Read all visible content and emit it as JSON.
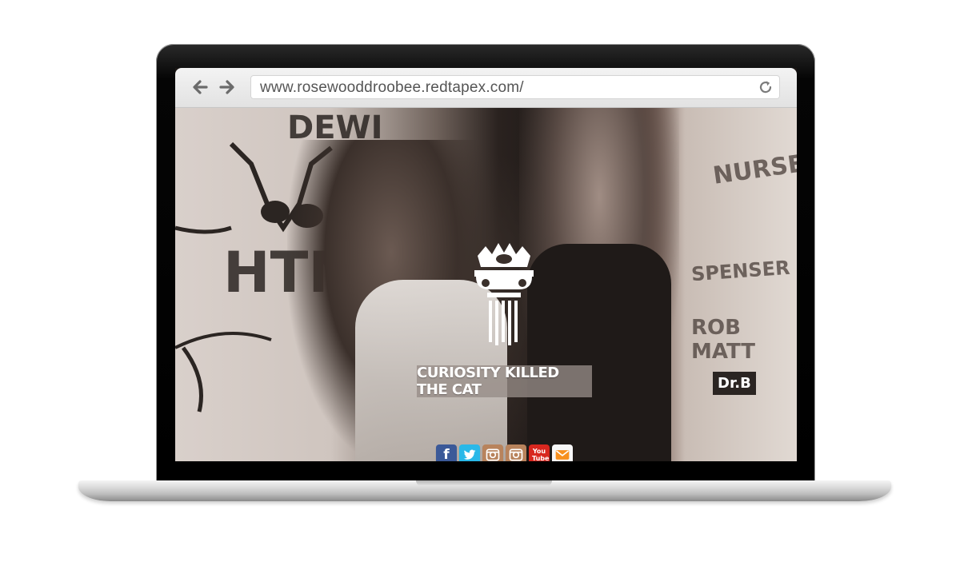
{
  "browser": {
    "url": "www.rosewooddroobee.redtapex.com/",
    "back_icon": "arrow-left-icon",
    "forward_icon": "arrow-right-icon",
    "reload_icon": "reload-icon"
  },
  "hero": {
    "logo_icon": "crown-column-logo",
    "title": "CURIOSITY KILLED THE CAT",
    "wall_left_text": [
      "DEWI",
      "HTN"
    ],
    "wall_right_text": [
      "NURSE",
      "SPENSER",
      "ROB MATT",
      "Dr.B"
    ]
  },
  "socials": [
    {
      "name": "facebook",
      "glyph": "f",
      "color": "#3b5998"
    },
    {
      "name": "twitter",
      "glyph": "t",
      "color": "#29b8e8"
    },
    {
      "name": "instagram",
      "glyph": "",
      "color": "#b8835c"
    },
    {
      "name": "instagram",
      "glyph": "",
      "color": "#b8835c"
    },
    {
      "name": "youtube",
      "glyph": "You Tube",
      "color": "#d8271f"
    },
    {
      "name": "email",
      "glyph": "",
      "color": "#f7901e"
    }
  ]
}
